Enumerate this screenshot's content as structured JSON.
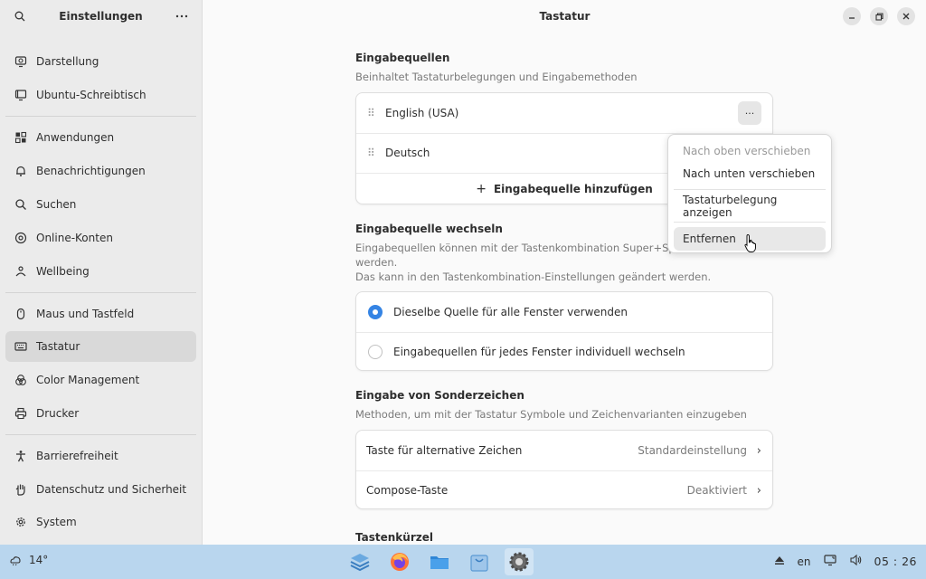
{
  "sidebar": {
    "title": "Einstellungen",
    "items": [
      {
        "label": "Darstellung",
        "icon": "display-icon"
      },
      {
        "label": "Ubuntu-Schreibtisch",
        "icon": "desktop-icon"
      },
      {
        "label": "Anwendungen",
        "icon": "apps-icon"
      },
      {
        "label": "Benachrichtigungen",
        "icon": "bell-icon"
      },
      {
        "label": "Suchen",
        "icon": "search-icon"
      },
      {
        "label": "Online-Konten",
        "icon": "at-icon"
      },
      {
        "label": "Wellbeing",
        "icon": "wellbeing-icon"
      },
      {
        "label": "Maus und Tastfeld",
        "icon": "mouse-icon"
      },
      {
        "label": "Tastatur",
        "icon": "keyboard-icon",
        "active": true
      },
      {
        "label": "Color Management",
        "icon": "color-icon"
      },
      {
        "label": "Drucker",
        "icon": "printer-icon"
      },
      {
        "label": "Barrierefreiheit",
        "icon": "accessibility-icon"
      },
      {
        "label": "Datenschutz und Sicherheit",
        "icon": "hand-icon"
      },
      {
        "label": "System",
        "icon": "gear-icon"
      }
    ]
  },
  "header": {
    "title": "Tastatur"
  },
  "sources": {
    "title": "Eingabequellen",
    "desc": "Beinhaltet Tastaturbelegungen und Eingabemethoden",
    "items": [
      "English (USA)",
      "Deutsch"
    ],
    "add_label": "Eingabequelle hinzufügen",
    "more_label": "···"
  },
  "popover": {
    "items": [
      {
        "label": "Nach oben verschieben",
        "disabled": true
      },
      {
        "label": "Nach unten verschieben"
      },
      {
        "label": "Tastaturbelegung anzeigen"
      },
      {
        "label": "Entfernen"
      }
    ]
  },
  "switching": {
    "title": "Eingabequelle wechseln",
    "desc_line1": "Eingabequellen können mit der Tastenkombination Super+Space",
    "desc_line2": "werden.",
    "desc_line3": "Das kann in den Tastenkombination-Einstellungen geändert werden.",
    "options": [
      {
        "label": "Dieselbe Quelle für alle Fenster verwenden",
        "selected": true
      },
      {
        "label": "Eingabequellen für jedes Fenster individuell wechseln",
        "selected": false
      }
    ]
  },
  "special": {
    "title": "Eingabe von Sonderzeichen",
    "desc": "Methoden, um mit der Tastatur Symbole und Zeichenvarianten einzugeben",
    "rows": [
      {
        "label": "Taste für alternative Zeichen",
        "value": "Standardeinstellung"
      },
      {
        "label": "Compose-Taste",
        "value": "Deaktiviert"
      }
    ]
  },
  "shortcuts": {
    "title": "Tastenkürzel"
  },
  "taskbar": {
    "temperature": "14°",
    "language": "en",
    "clock": "05 : 26"
  },
  "colors": {
    "accent": "#3584e4",
    "taskbar": "#b9d6ee"
  }
}
